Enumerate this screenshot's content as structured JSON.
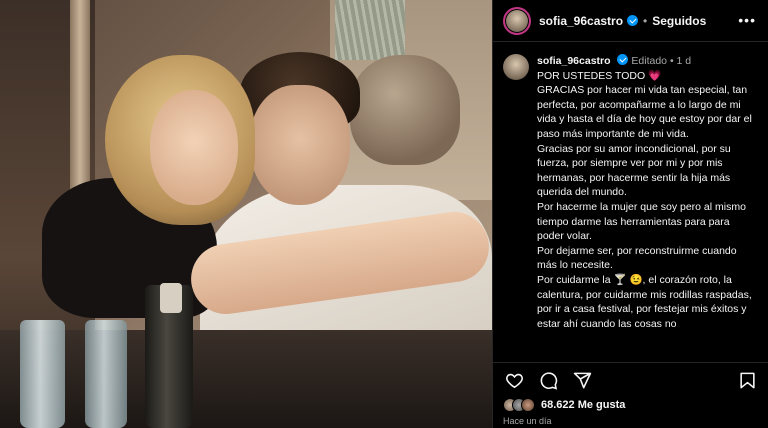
{
  "header": {
    "username": "sofia_96castro",
    "separator": "•",
    "follow_label": "Seguidos",
    "more_label": "•••"
  },
  "caption": {
    "username": "sofia_96castro",
    "edited_label": "Editado",
    "time": "1 d",
    "lines": [
      "POR USTEDES TODO ",
      "GRACIAS por hacer mi vida tan especial, tan perfecta, por acompañarme a lo largo de mi vida y hasta el día de hoy que estoy por dar el paso más importante de mi vida.",
      "Gracias por su amor incondicional, por su fuerza, por siempre ver por mi y por mis hermanas, por hacerme sentir la hija más querida del mundo.",
      "Por hacerme la mujer que soy pero al mismo tiempo darme las herramientas para para poder volar.",
      "Por dejarme ser, por reconstruirme cuando más lo necesite.",
      "Por cuidarme la ",
      ", el corazón roto, la calentura, por cuidarme mis rodillas raspadas, por ir a casa festival, por festejar mis éxitos y estar ahí cuando las cosas no"
    ],
    "emoji_heart": "💗",
    "emoji_cocktail": "🍸",
    "emoji_face": "😉"
  },
  "actions": {
    "like_icon": "heart-icon",
    "comment_icon": "comment-icon",
    "share_icon": "share-icon",
    "save_icon": "bookmark-icon"
  },
  "likes": {
    "count": "68.622",
    "label": "Me gusta"
  },
  "timestamp": "Hace un día",
  "colors": {
    "verified": "#0095f6",
    "background": "#000000",
    "secondary_text": "#a8a8a8"
  }
}
